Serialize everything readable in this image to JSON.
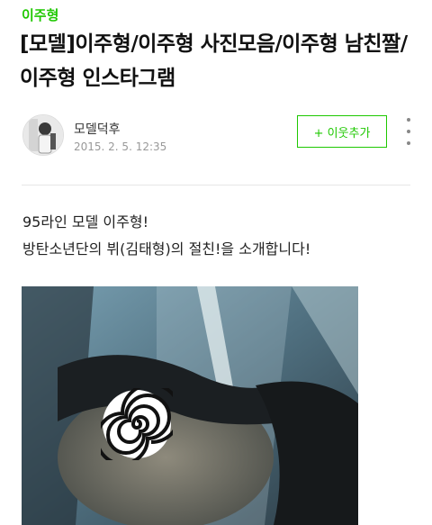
{
  "post": {
    "category": "이주형",
    "title": "[모델]이주형/이주형 사진모음/이주형 남친짤/이주형 인스타그램",
    "author": "모델덕후",
    "date": "2015. 2. 5. 12:35",
    "add_neighbor_label": "+ 이웃추가",
    "more_icon": "vertical-ellipsis-icon",
    "body_lines": [
      "95라인 모델 이주형!",
      "방탄소년단의 뷔(김태형)의 절친!을 소개합니다!"
    ],
    "photo": {
      "description_icon": "spiral-censor-icon"
    }
  },
  "colors": {
    "accent": "#1ec800",
    "text": "#222222",
    "muted": "#999999"
  }
}
